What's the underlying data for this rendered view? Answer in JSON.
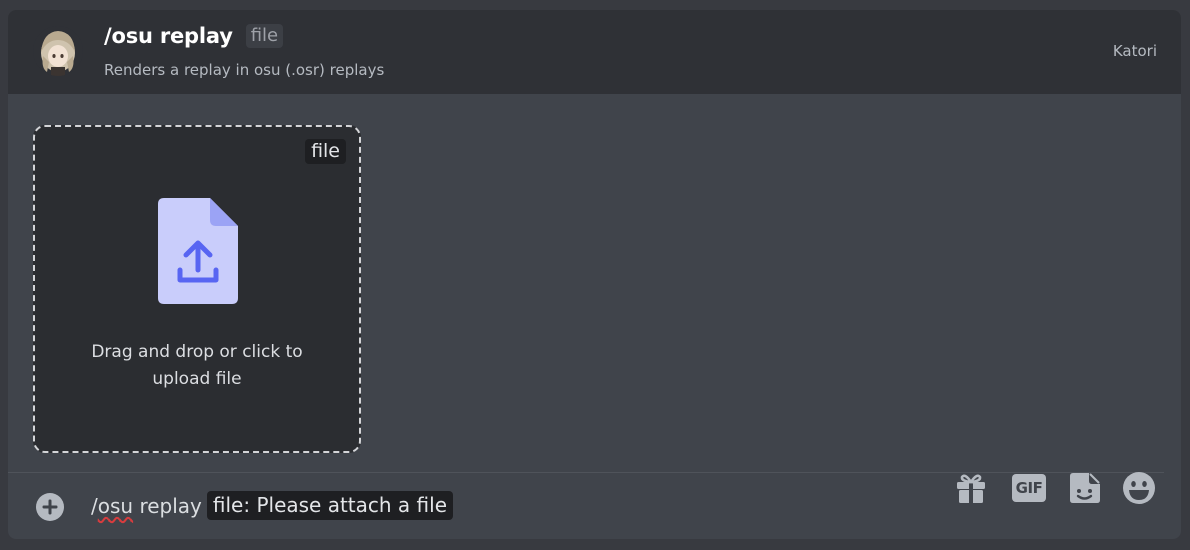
{
  "header": {
    "command": "/osu replay",
    "option_pill": "file",
    "description": "Renders a replay in osu (.osr) replays",
    "bot_name": "Katori",
    "avatar_icon": "bot-avatar"
  },
  "dropzone": {
    "tag": "file",
    "text": "Drag and drop or click to upload file",
    "icon": "file-upload-icon"
  },
  "input": {
    "slash": "/",
    "command_word": "osu",
    "command_rest": "replay",
    "option_field": "file: Please attach a file"
  },
  "toolbar": {
    "add_icon": "plus-circle-icon",
    "gift_icon": "gift-icon",
    "gif_label": "GIF",
    "sticker_icon": "sticker-icon",
    "emoji_icon": "emoji-icon"
  },
  "colors": {
    "accent": "#5865f2",
    "file_icon_bg": "#c9cdfb"
  }
}
